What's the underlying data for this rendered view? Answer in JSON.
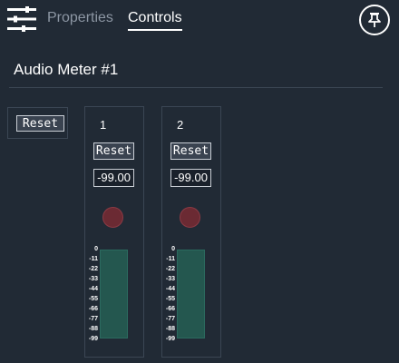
{
  "header": {
    "tabs": [
      {
        "label": "Properties",
        "active": false
      },
      {
        "label": "Controls",
        "active": true
      }
    ],
    "settings_icon": "sliders-icon",
    "pin_icon": "pushpin-icon"
  },
  "page": {
    "title": "Audio Meter #1"
  },
  "global_controls": {
    "reset_label": "Reset"
  },
  "channels": [
    {
      "number": "1",
      "reset_label": "Reset",
      "value": "-99.00",
      "level": 1.0
    },
    {
      "number": "2",
      "reset_label": "Reset",
      "value": "-99.00",
      "level": 1.0
    }
  ],
  "meter_scale": [
    "0",
    "-11",
    "-22",
    "-33",
    "-44",
    "-55",
    "-66",
    "-77",
    "-88",
    "-99"
  ],
  "colors": {
    "background": "#212a35",
    "panel_border": "#3b4654",
    "meter_fill": "#24574f",
    "led_off": "#6b2a33",
    "inactive_tab": "#8c96a3"
  }
}
